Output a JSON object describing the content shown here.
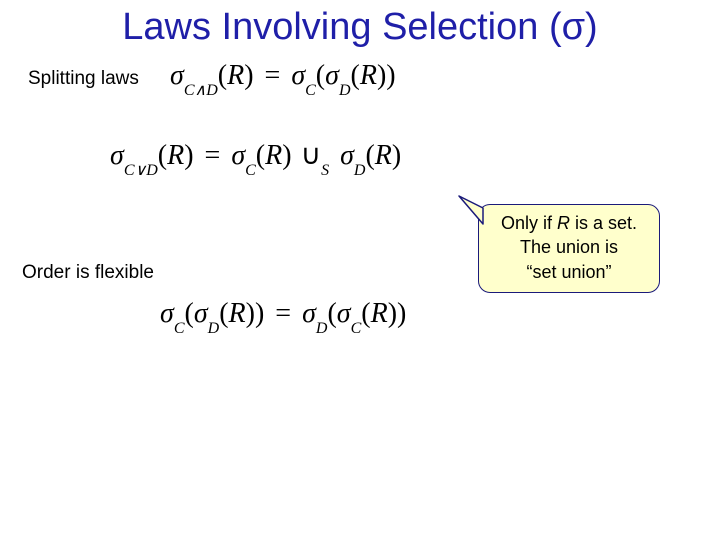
{
  "title": "Laws Involving Selection (σ)",
  "subhead1": "Splitting laws",
  "subhead2": "Order is flexible",
  "callout": {
    "line1_prefix": "Only if ",
    "line1_var": "R",
    "line1_suffix": " is a set.",
    "line2": "The union is",
    "line3": "“set union”"
  },
  "eq1": {
    "lhs_sym": "σ",
    "lhs_sub": "C∧D",
    "lhs_arg": "R",
    "rhs_sym1": "σ",
    "rhs_sub1": "C",
    "rhs_sym2": "σ",
    "rhs_sub2": "D",
    "rhs_arg": "R",
    "eq": "="
  },
  "eq2": {
    "lhs_sym": "σ",
    "lhs_sub": "C∨D",
    "lhs_arg": "R",
    "eq": "=",
    "r1_sym": "σ",
    "r1_sub": "C",
    "r1_arg": "R",
    "union": "∪",
    "union_sub": "S",
    "r2_sym": "σ",
    "r2_sub": "D",
    "r2_arg": "R"
  },
  "eq3": {
    "l_sym1": "σ",
    "l_sub1": "C",
    "l_sym2": "σ",
    "l_sub2": "D",
    "l_arg": "R",
    "eq": "=",
    "r_sym1": "σ",
    "r_sub1": "D",
    "r_sym2": "σ",
    "r_sub2": "C",
    "r_arg": "R"
  }
}
